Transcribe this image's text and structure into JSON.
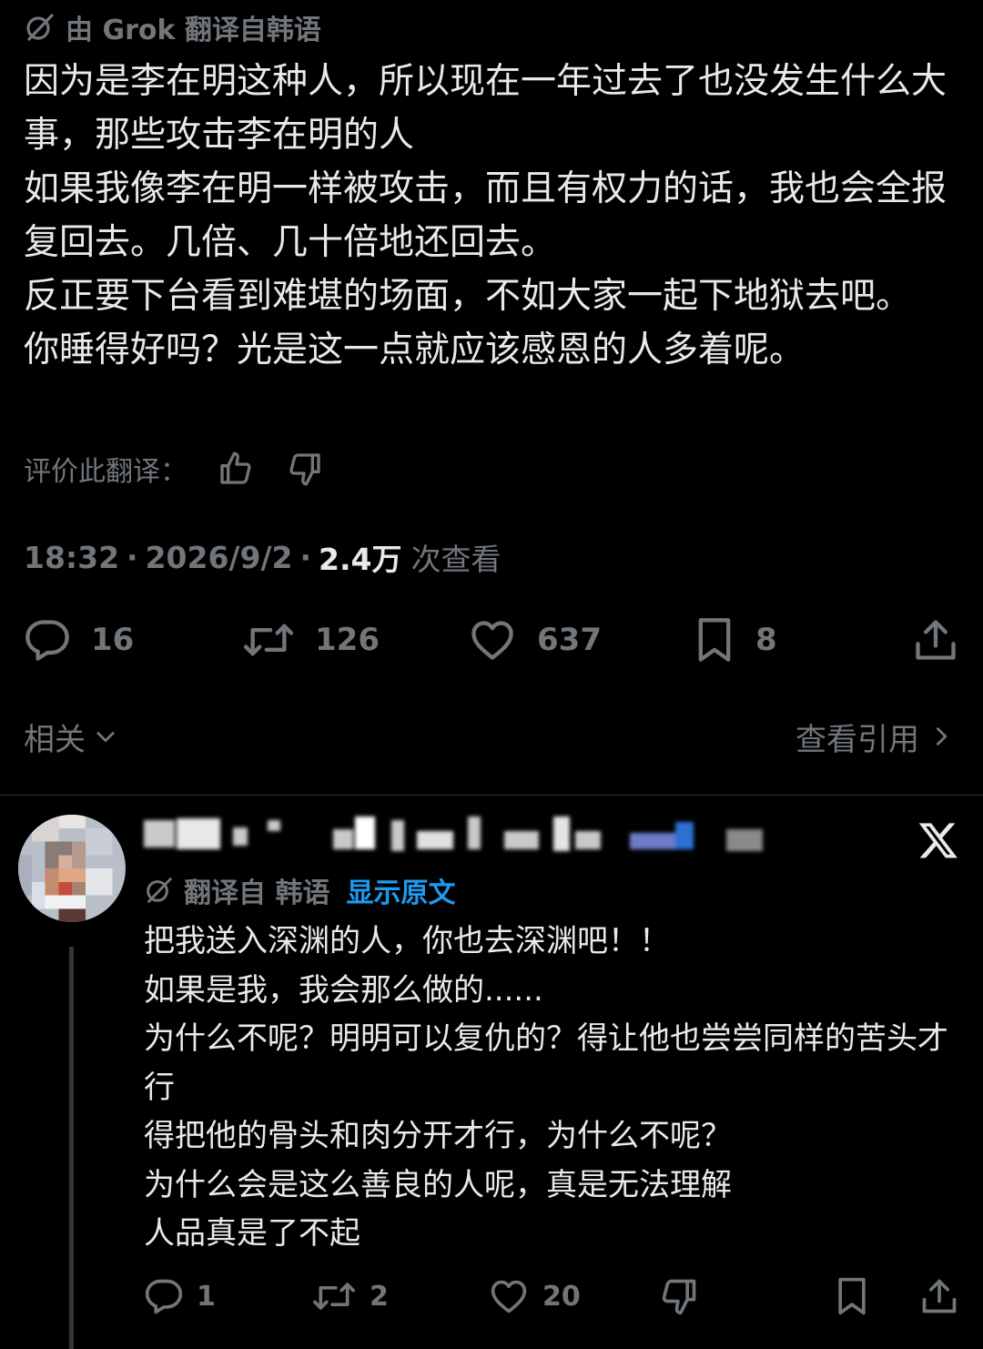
{
  "colors": {
    "background": "#000000",
    "text": "#e7e9ea",
    "muted": "#71767b",
    "link": "#1d9bf0"
  },
  "tweet": {
    "translation_label": "由 Grok 翻译自韩语",
    "translation_icon": "grok-icon",
    "lines": [
      "因为是李在明这种人，所以现在一年过去了也没发生什么大事，那些攻击李在明的人",
      "如果我像李在明一样被攻击，而且有权力的话，我也会全报复回去。几倍、几十倍地还回去。",
      "反正要下台看到难堪的场面，不如大家一起下地狱去吧。",
      "你睡得好吗？光是这一点就应该感恩的人多着呢。"
    ],
    "rate_label": "评价此翻译：",
    "time": "18:32",
    "date": "2026/9/2",
    "views_count": "2.4万",
    "views_label": "次查看",
    "actions": {
      "replies": "16",
      "reposts": "126",
      "likes": "637",
      "bookmarks": "8"
    },
    "related_label": "相关",
    "quotes_label": "查看引用"
  },
  "reply": {
    "translation_label": "翻译自 韩语",
    "show_original_label": "显示原文",
    "lines": [
      "把我送入深渊的人，你也去深渊吧！！",
      "如果是我，我会那么做的......",
      "为什么不呢？明明可以复仇的？得让他也尝尝同样的苦头才行",
      "得把他的骨头和肉分开才行，为什么不呢？",
      "为什么会是这么善良的人呢，真是无法理解",
      "人品真是了不起"
    ],
    "actions": {
      "replies": "1",
      "reposts": "2",
      "likes": "20"
    }
  }
}
